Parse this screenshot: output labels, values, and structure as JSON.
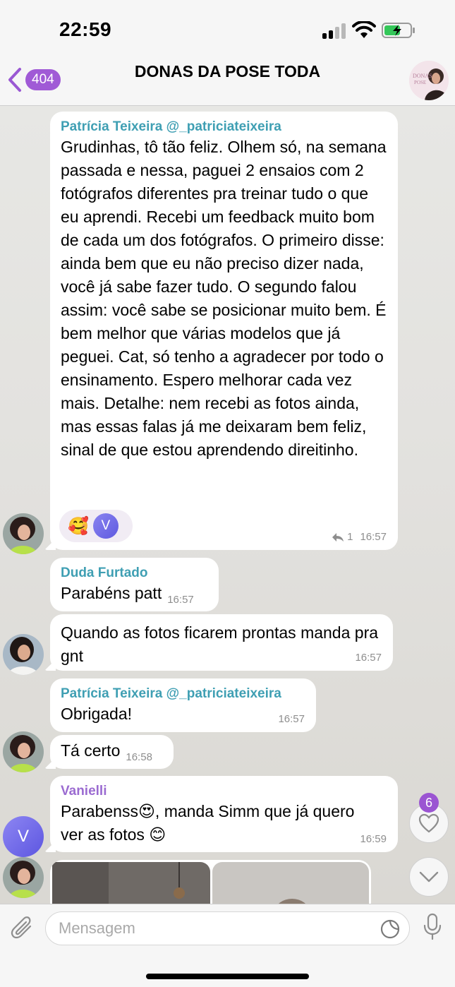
{
  "status_bar": {
    "time": "22:59"
  },
  "header": {
    "back_count": "404",
    "title": "DONAS DA POSE TODA"
  },
  "messages": [
    {
      "sender": "Patrícia Teixeira @_patriciateixeira",
      "text": "Grudinhas, tô tão feliz. Olhem só, na semana passada e nessa, paguei 2 ensaios com 2 fotógrafos diferentes pra treinar tudo o que eu aprendi. Recebi um feedback muito bom de cada um dos fotógrafos. O primeiro disse: ainda bem que eu não preciso dizer nada, você já sabe fazer tudo. O segundo falou assim: você sabe se posicionar muito bem. É bem melhor que várias modelos que já peguei. Cat, só tenho a agradecer por todo o ensinamento. Espero melhorar cada vez mais. Detalhe: nem recebi as fotos ainda, mas essas falas já me deixaram bem feliz, sinal de que estou aprendendo direitinho.",
      "reaction_emoji": "🥰",
      "reaction_user": "V",
      "reply_count": "1",
      "time": "16:57"
    },
    {
      "sender": "Duda Furtado",
      "text": "Parabéns patt",
      "time": "16:57"
    },
    {
      "text": "Quando as fotos ficarem prontas manda pra gnt",
      "time": "16:57"
    },
    {
      "sender": "Patrícia Teixeira @_patriciateixeira",
      "text": "Obrigada!",
      "time": "16:57"
    },
    {
      "text": "Tá certo",
      "time": "16:58"
    },
    {
      "sender": "Vanielli",
      "text_line1": "Parabenss😍, manda Simm que já quero",
      "text_line2": "ver as fotos 😊",
      "time": "16:59"
    }
  ],
  "floating": {
    "unread_reactions": "6",
    "user_initial": "V"
  },
  "input": {
    "placeholder": "Mensagem"
  },
  "colors": {
    "accent": "#a05ad6",
    "sender_teal": "#3f9fb3",
    "sender_purple": "#9b6bd1",
    "outgoing_bg": "#ffffff"
  }
}
